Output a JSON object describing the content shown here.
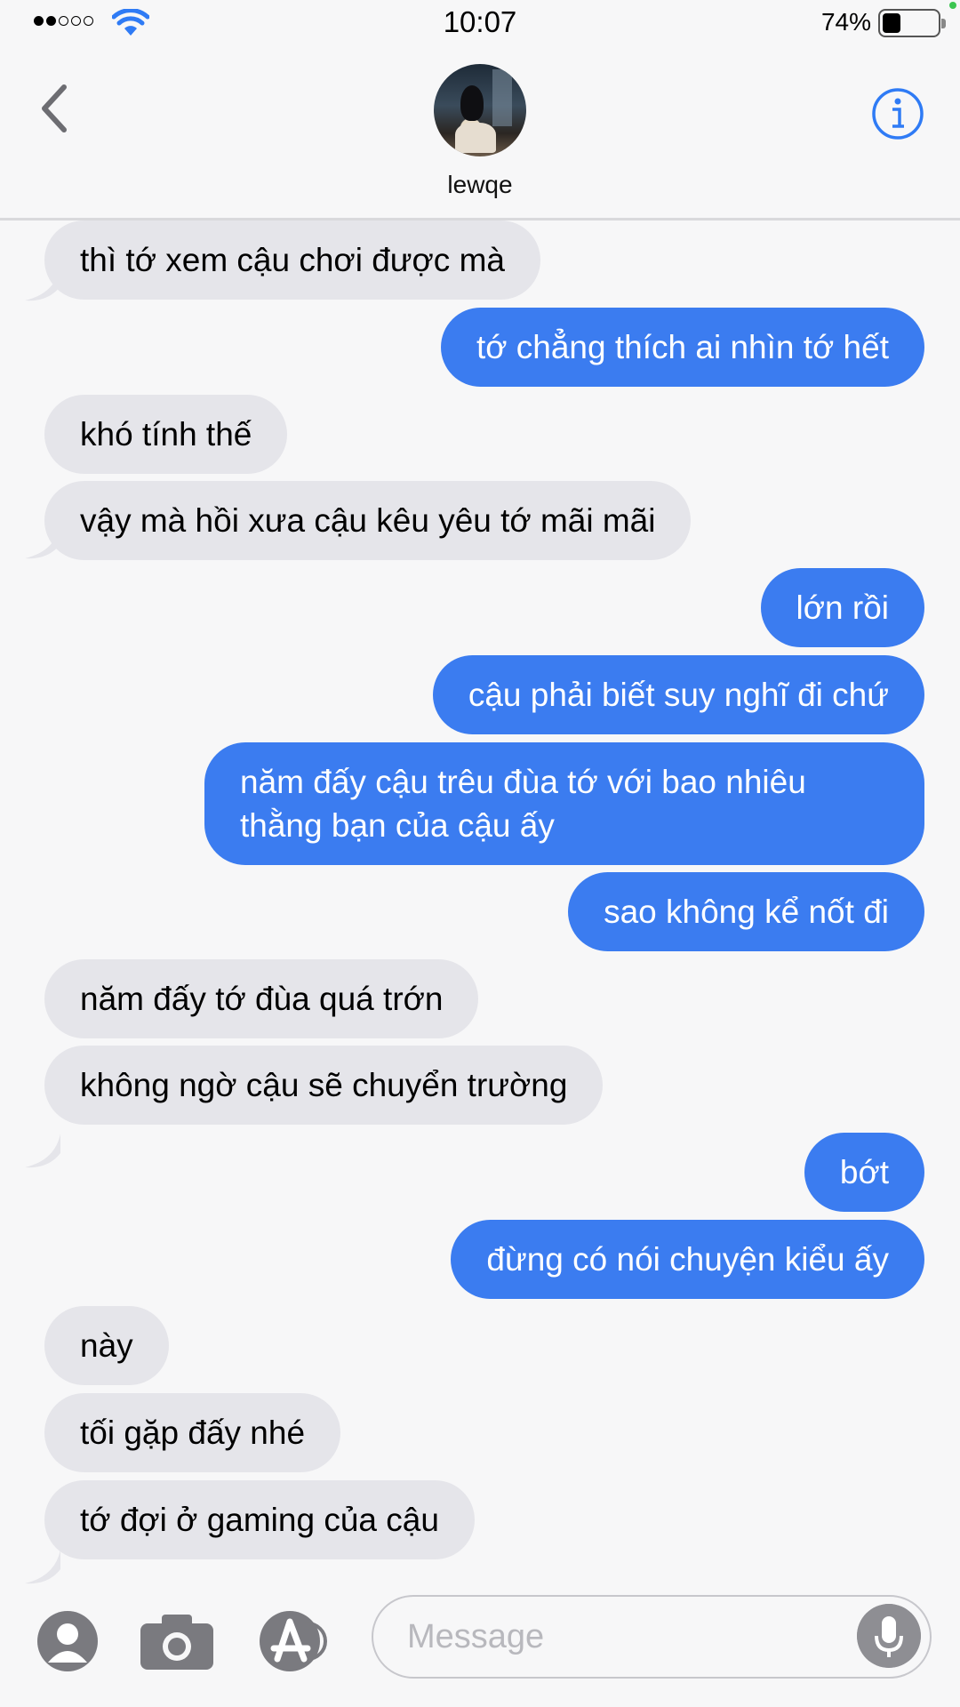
{
  "status": {
    "time": "10:07",
    "battery": "74%",
    "battery_level": 0.74
  },
  "header": {
    "contact": "lewqe"
  },
  "icons": {
    "back": "chevron-left-icon",
    "info": "info-icon",
    "contacts": "person-icon",
    "camera": "camera-icon",
    "apps": "app-store-icon",
    "mic": "microphone-icon"
  },
  "messages": [
    {
      "dir": "in",
      "text": "thì tớ xem cậu chơi được mà"
    },
    {
      "dir": "out",
      "text": "tớ chẳng thích ai nhìn tớ hết"
    },
    {
      "dir": "in",
      "text": "khó tính thế"
    },
    {
      "dir": "in",
      "text": "vậy mà hồi xưa cậu kêu yêu tớ mãi mãi"
    },
    {
      "dir": "out",
      "text": "lớn rồi"
    },
    {
      "dir": "out",
      "text": "cậu phải biết suy nghĩ đi chứ"
    },
    {
      "dir": "out",
      "text": "năm đấy cậu trêu đùa tớ với bao nhiêu thằng bạn của cậu ấy"
    },
    {
      "dir": "out",
      "text": "sao không kể nốt đi"
    },
    {
      "dir": "in",
      "text": "năm đấy tớ đùa quá trớn"
    },
    {
      "dir": "in",
      "text": "không ngờ cậu sẽ chuyển trường"
    },
    {
      "dir": "out",
      "text": "bớt"
    },
    {
      "dir": "out",
      "text": "đừng có nói chuyện kiểu ấy"
    },
    {
      "dir": "in",
      "text": "này"
    },
    {
      "dir": "in",
      "text": "tối gặp đấy nhé"
    },
    {
      "dir": "in",
      "text": "tớ đợi ở gaming của cậu"
    }
  ],
  "input": {
    "placeholder": "Message"
  },
  "colors": {
    "outgoing": "#3b7cf0",
    "incoming": "#e5e5ea",
    "accent": "#2f7bf5"
  }
}
